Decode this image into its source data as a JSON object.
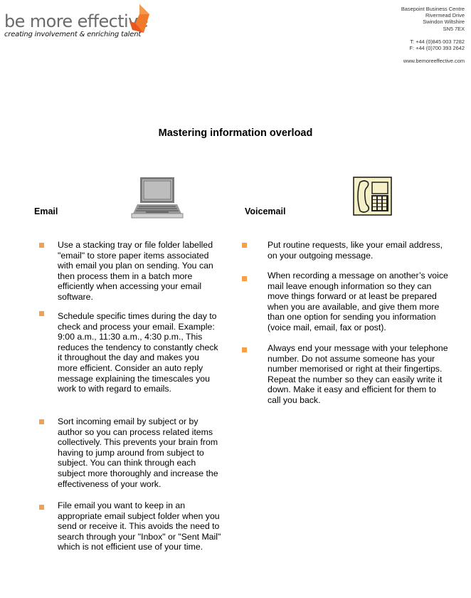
{
  "header": {
    "logo": {
      "name": "be more effective",
      "tagline": "creating involvement & enriching talent",
      "accent_color": "#e8561e"
    },
    "address_lines": [
      "Basepoint Business Centre",
      "Rivermead Drive",
      "Swindon Wiltshire",
      "SN5 7EX"
    ],
    "phone": "T:  +44 (0)845 003 7282",
    "fax": "F:  +44 (0)700 393 2642",
    "website": "www.bemoreeffective.com"
  },
  "document": {
    "title": "Mastering information overload",
    "bullet_color": "#f5a04a",
    "sections": [
      {
        "heading": "Email",
        "icon": "laptop-icon",
        "items": [
          "Use a stacking tray or file folder labelled \"email\" to store paper items associated with email you plan on sending. You can then process them in a batch more efficiently when accessing your email software.",
          "Schedule specific times during the day to check and process your email.  Example: 9:00 a.m., 11:30 a.m., 4:30 p.m., This reduces the tendency to constantly check    it throughout the day and makes you more efficient.  Consider an auto reply message explaining the timescales you work to with regard to emails.",
          "Sort incoming email by subject or by author so you can process related items collectively. This prevents your brain from having to jump around from subject to subject. You can think through each subject more thoroughly and increase the effectiveness of your work.",
          "File email you want to keep in an appropriate email subject folder when you send or receive it. This avoids the need to search through your \"Inbox\" or \"Sent Mail\" which is not efficient use of your time."
        ]
      },
      {
        "heading": "Voicemail",
        "icon": "telephone-icon",
        "items": [
          "Put routine requests, like your email address, on your outgoing message.",
          "When recording a message on another’s voice mail leave enough information so they can move things forward or at least be prepared when you are available, and give them more than one option for sending you information (voice mail, email, fax or post).",
          "Always end your message with your telephone number. Do not assume someone has your number memorised or right at their fingertips. Repeat the number so they can easily write it down. Make it easy and efficient for them to call you back."
        ]
      }
    ]
  }
}
